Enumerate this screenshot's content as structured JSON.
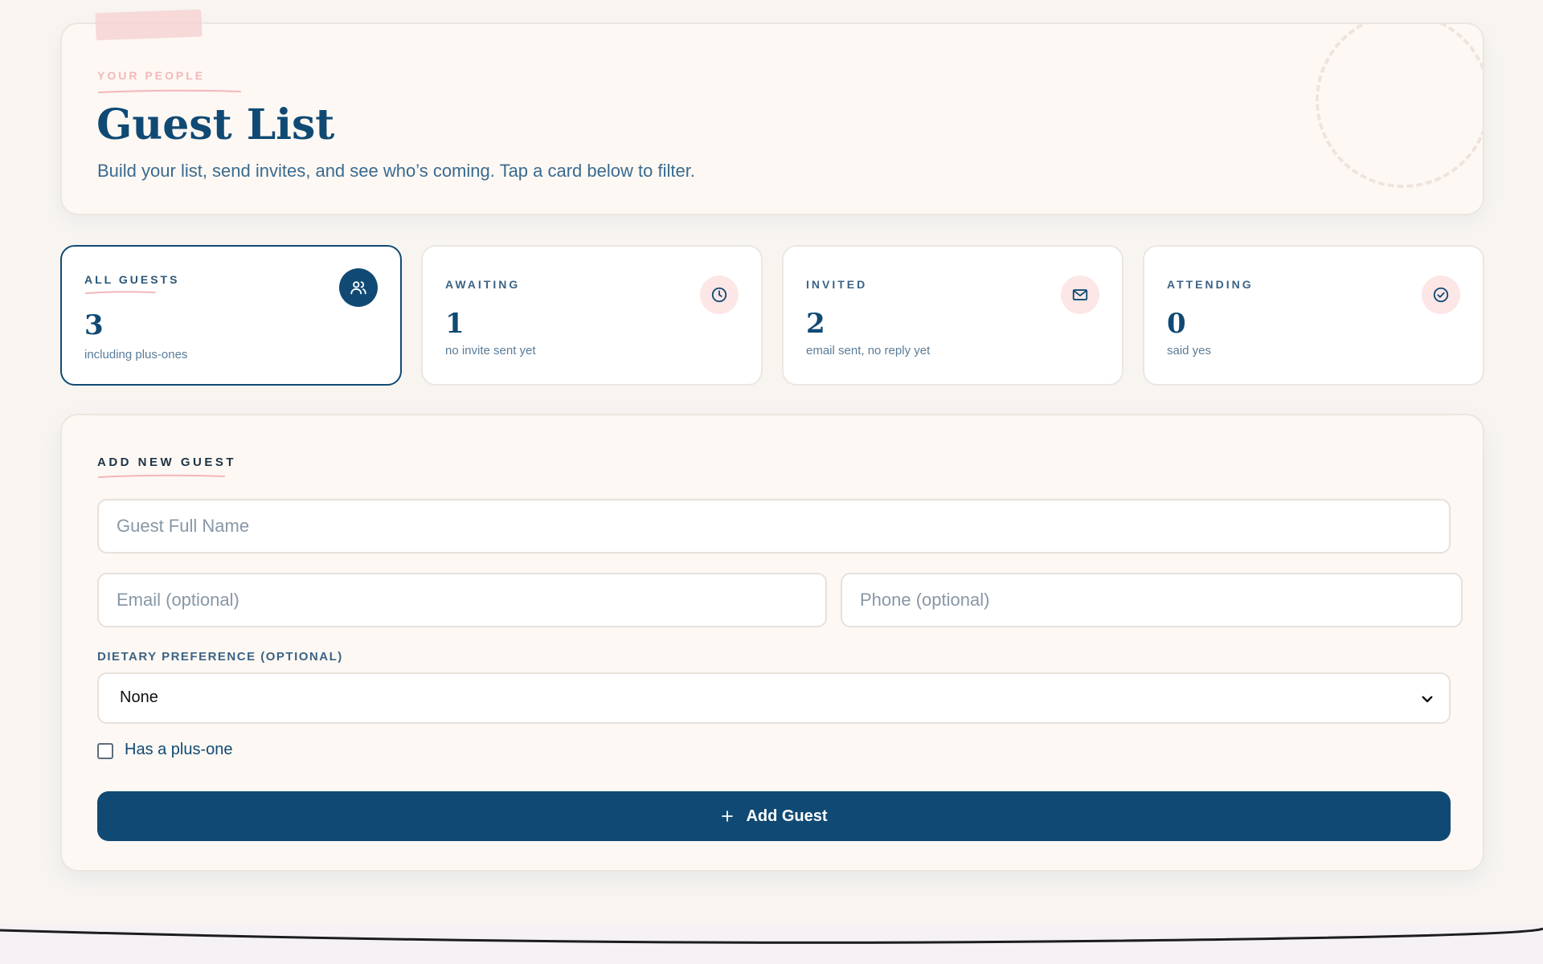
{
  "header": {
    "eyebrow": "YOUR PEOPLE",
    "title": "Guest List",
    "subtitle": "Build your list, send invites, and see who’s coming. Tap a card below to filter."
  },
  "stats": [
    {
      "label": "ALL GUESTS",
      "value": "3",
      "caption": "including plus-ones",
      "icon": "users-icon",
      "active": true
    },
    {
      "label": "AWAITING",
      "value": "1",
      "caption": "no invite sent yet",
      "icon": "clock-icon",
      "active": false
    },
    {
      "label": "INVITED",
      "value": "2",
      "caption": "email sent, no reply yet",
      "icon": "mail-icon",
      "active": false
    },
    {
      "label": "ATTENDING",
      "value": "0",
      "caption": "said yes",
      "icon": "check-circle-icon",
      "active": false
    }
  ],
  "form": {
    "title": "ADD NEW GUEST",
    "name_placeholder": "Guest Full Name",
    "email_placeholder": "Email (optional)",
    "phone_placeholder": "Phone (optional)",
    "dietary_label": "DIETARY PREFERENCE (OPTIONAL)",
    "dietary_selected": "None",
    "plus_one_label": "Has a plus-one",
    "plus_one_checked": false,
    "add_button_label": "Add Guest"
  },
  "colors": {
    "primary": "#104a74",
    "accent_pink": "#f3b7bb",
    "background": "#f8f5f1",
    "card": "#fdf8f3"
  }
}
